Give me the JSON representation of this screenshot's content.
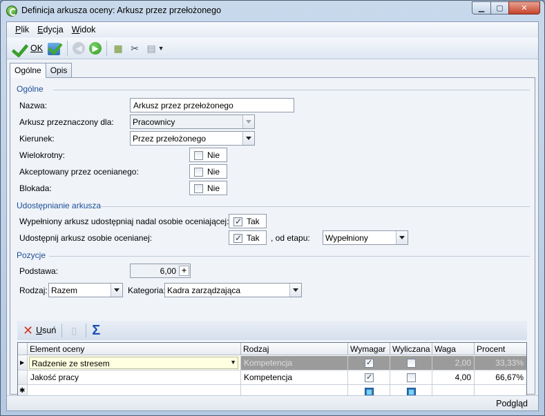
{
  "window": {
    "title": "Definicja arkusza oceny: Arkusz przez przełożonego"
  },
  "menu": [
    {
      "u": "P",
      "rest": "lik"
    },
    {
      "u": "E",
      "rest": "dycja"
    },
    {
      "u": "W",
      "rest": "idok"
    }
  ],
  "toolbar": {
    "ok_label": "OK"
  },
  "tabs": [
    {
      "label": "Ogólne",
      "active": true
    },
    {
      "label": "Opis",
      "active": false
    }
  ],
  "ogolne": {
    "group_title": "Ogólne",
    "nazwa_label": "Nazwa:",
    "nazwa_value": "Arkusz przez przełożonego",
    "przeznaczony_label": "Arkusz przeznaczony dla:",
    "przeznaczony_value": "Pracownicy",
    "kierunek_label": "Kierunek:",
    "kierunek_value": "Przez przełożonego",
    "wielokrotny_label": "Wielokrotny:",
    "wielokrotny_value": "Nie",
    "akceptowany_label": "Akceptowany przez ocenianego:",
    "akceptowany_value": "Nie",
    "blokada_label": "Blokada:",
    "blokada_value": "Nie"
  },
  "udostepnianie": {
    "group_title": "Udostępnianie arkusza",
    "nadal_label": "Wypełniony arkusz udostępniaj nadal osobie oceniającej:",
    "nadal_value": "Tak",
    "ocenianej_label": "Udostępnij arkusz osobie ocenianej:",
    "ocenianej_value": "Tak",
    "od_etapu_label": ", od etapu:",
    "od_etapu_value": "Wypełniony"
  },
  "pozycje": {
    "group_title": "Pozycje",
    "podstawa_label": "Podstawa:",
    "podstawa_value": "6,00",
    "rodzaj_label": "Rodzaj:",
    "rodzaj_value": "Razem",
    "kategoria_label": "Kategoria:",
    "kategoria_value": "Kadra zarządzająca",
    "usun_u": "U",
    "usun_rest": "suń"
  },
  "grid": {
    "columns": [
      "Element oceny",
      "Rodzaj",
      "Wymagar",
      "Wyliczana",
      "Waga",
      "Procent"
    ],
    "rows": [
      {
        "element": "Radzenie ze stresem",
        "rodzaj": "Kompetencja",
        "wymagany": true,
        "wyliczana": false,
        "waga": "2,00",
        "procent": "33,33%"
      },
      {
        "element": "Jakość pracy",
        "rodzaj": "Kompetencja",
        "wymagany": true,
        "wyliczana": false,
        "waga": "4,00",
        "procent": "66,67%"
      }
    ]
  },
  "status": {
    "text": "Podgląd"
  }
}
